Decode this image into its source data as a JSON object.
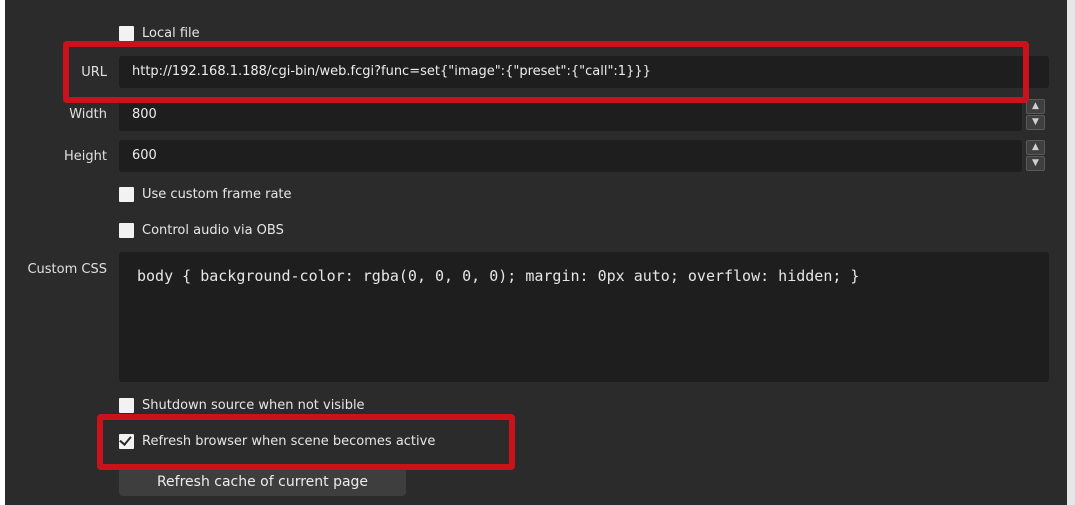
{
  "form": {
    "local_file_label": "Local file",
    "url_label": "URL",
    "url_value": "http://192.168.1.188/cgi-bin/web.fcgi?func=set{\"image\":{\"preset\":{\"call\":1}}}",
    "width_label": "Width",
    "width_value": "800",
    "height_label": "Height",
    "height_value": "600",
    "custom_frame_rate_label": "Use custom frame rate",
    "control_audio_label": "Control audio via OBS",
    "custom_css_label": "Custom CSS",
    "custom_css_value": "body { background-color: rgba(0, 0, 0, 0); margin: 0px auto; overflow: hidden; }",
    "shutdown_label": "Shutdown source when not visible",
    "refresh_on_active_label": "Refresh browser when scene becomes active",
    "refresh_cache_label": "Refresh cache of current page"
  },
  "states": {
    "local_file": false,
    "custom_frame_rate": false,
    "control_audio": false,
    "shutdown": false,
    "refresh_on_active": true
  },
  "colors": {
    "panel_bg": "#2b2b2b",
    "field_bg": "#1e1e1e",
    "highlight": "#c9121b"
  }
}
